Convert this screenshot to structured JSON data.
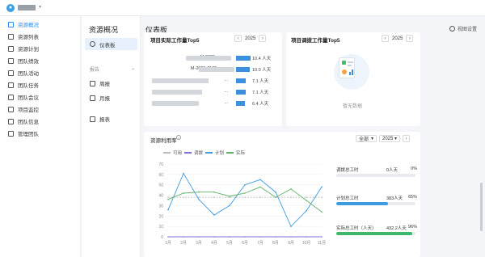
{
  "header": {
    "avatar_icon": "user-icon"
  },
  "sidebar": {
    "items": [
      {
        "label": "资源概况",
        "icon": "resource-overview-icon",
        "active": true
      },
      {
        "label": "资源列表",
        "icon": "list-icon"
      },
      {
        "label": "资源计划",
        "icon": "plan-icon"
      },
      {
        "label": "团队绩效",
        "icon": "performance-icon"
      },
      {
        "label": "团队活动",
        "icon": "activity-icon"
      },
      {
        "label": "团队任务",
        "icon": "task-icon"
      },
      {
        "label": "团队会议",
        "icon": "meeting-icon"
      },
      {
        "label": "项目监控",
        "icon": "monitor-icon"
      },
      {
        "label": "团队信息",
        "icon": "info-icon"
      },
      {
        "label": "管理团队",
        "icon": "manage-icon"
      }
    ]
  },
  "subnav": {
    "title": "资源概况",
    "dashboard_label": "仪表板",
    "group_label": "报告",
    "weekly_label": "周报",
    "monthly_label": "月报",
    "report_label": "报表"
  },
  "page": {
    "title": "仪表板",
    "layout_settings": "视图设置"
  },
  "top5_actual": {
    "title": "项目实际工作量Top5",
    "year": "2025",
    "rows": [
      {
        "label": "M-2025-",
        "value": 10.4,
        "text": "10.4 人天"
      },
      {
        "label": "M-2025-TMP",
        "value": 10.0,
        "text": "10.0 人天"
      },
      {
        "label": "",
        "suffix": "...",
        "value": 7.1,
        "text": "7.1 人天"
      },
      {
        "label": "",
        "suffix": "...",
        "value": 7.1,
        "text": "7.1 人天"
      },
      {
        "label": "",
        "suffix": "...",
        "value": 6.4,
        "text": "6.4 人天"
      }
    ]
  },
  "top5_adjust": {
    "title": "项目调拨工作量Top5",
    "year": "2025",
    "empty_text": "暂无数据"
  },
  "utilization": {
    "title": "资源利用率",
    "scope": "全部",
    "year": "2025",
    "stats": [
      {
        "name": "调拨总工时",
        "value": "0人天",
        "pct": "0%",
        "ratio": 0.0,
        "color": "#8a6fd8"
      },
      {
        "name": "计划总工时",
        "value": "383人天",
        "pct": "65%",
        "ratio": 0.65,
        "color": "#3d9be0"
      },
      {
        "name": "实际总工时（人天）",
        "value": "432.2人天",
        "pct": "96%",
        "ratio": 0.96,
        "color": "#3db86a"
      }
    ]
  },
  "chart_data": {
    "type": "line",
    "categories": [
      "1月",
      "2月",
      "3月",
      "4月",
      "5月",
      "6月",
      "7月",
      "8月",
      "9月",
      "10月",
      "11月"
    ],
    "ylim": [
      0,
      70
    ],
    "yticks": [
      0,
      10,
      20,
      30,
      40,
      50,
      60,
      70
    ],
    "series": [
      {
        "name": "可用",
        "color": "#b9bcc2",
        "dashed": true,
        "values": [
          38,
          38,
          38,
          38,
          38,
          38,
          38,
          38,
          38,
          38,
          38
        ]
      },
      {
        "name": "调拨",
        "color": "#7b6fd6",
        "values": [
          0,
          0,
          0,
          0,
          0,
          0,
          0,
          0,
          0,
          0,
          0
        ]
      },
      {
        "name": "计划",
        "color": "#3d9be0",
        "values": [
          26,
          61,
          36,
          21,
          30,
          50,
          55,
          43,
          10,
          25,
          48
        ]
      },
      {
        "name": "实际",
        "color": "#5fb368",
        "values": [
          36,
          42,
          43,
          43,
          39,
          42,
          48,
          38,
          46,
          35,
          24
        ]
      }
    ]
  }
}
